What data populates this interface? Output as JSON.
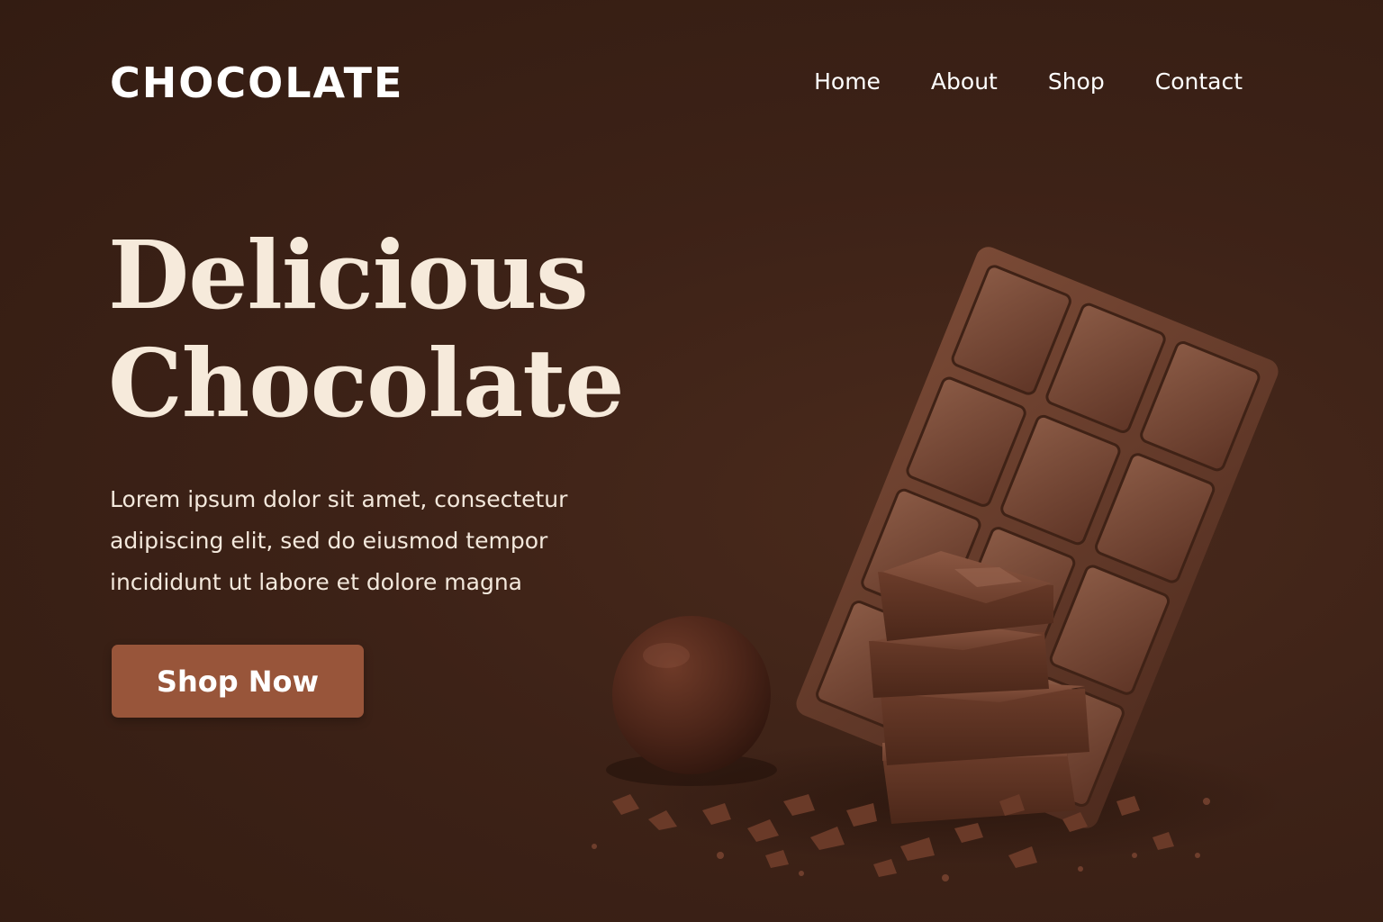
{
  "header": {
    "logo": "CHOCOLATE",
    "nav": [
      "Home",
      "About",
      "Shop",
      "Contact"
    ]
  },
  "hero": {
    "title_line1": "Delicious",
    "title_line2": "Chocolate",
    "text_lines": [
      "Lorem ipsum dolor sit amet, consectetur",
      "adipiscing elit, sed do eiusmod tempor",
      "incididunt ut labore et dolore magna"
    ],
    "cta_label": "Shop Now"
  },
  "colors": {
    "background": "#3d2217",
    "button": "#98553a",
    "heading": "#f6eadb"
  }
}
